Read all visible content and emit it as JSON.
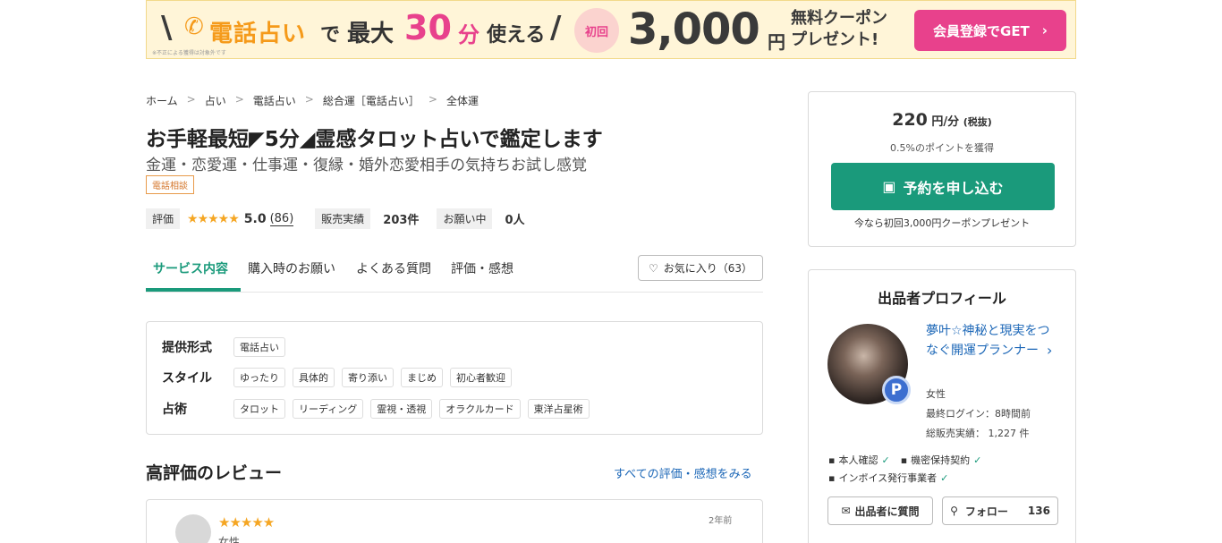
{
  "banner": {
    "line1": "電話占い",
    "line2": "で",
    "line3": "最大",
    "minutes": "30",
    "minutes_unit": "分",
    "line4": "使える",
    "first_time": "初回",
    "amount": "3,000",
    "yen": "円",
    "coupon_line1": "無料クーポン",
    "coupon_line2": "プレゼント!",
    "note": "※不正による獲得は対象外です",
    "cta": "会員登録でGET"
  },
  "breadcrumb": [
    "ホーム",
    "占い",
    "電話占い",
    "総合運［電話占い］",
    "全体運"
  ],
  "title": "お手軽最短◤5分◢霊感タロット占いで鑑定します",
  "subtitle": "金運・恋愛運・仕事運・復縁・婚外恋愛相手の気持ちお試し感覚",
  "category_tag": "電話相談",
  "stats": {
    "rating_label": "評価",
    "stars": "★★★★★",
    "rating": "5.0",
    "rating_count": "(86)",
    "sales_label": "販売実績",
    "sales_value": "203件",
    "requests_label": "お願い中",
    "requests_value": "0人"
  },
  "tabs": [
    "サービス内容",
    "購入時のお願い",
    "よくある質問",
    "評価・感想"
  ],
  "favorite": "お気に入り（63）",
  "spec": {
    "format_label": "提供形式",
    "format": [
      "電話占い"
    ],
    "style_label": "スタイル",
    "styles": [
      "ゆったり",
      "具体的",
      "寄り添い",
      "まじめ",
      "初心者歓迎"
    ],
    "method_label": "占術",
    "methods": [
      "タロット",
      "リーディング",
      "霊視・透視",
      "オラクルカード",
      "東洋占星術"
    ]
  },
  "reviews": {
    "title": "高評価のレビュー",
    "link": "すべての評価・感想をみる",
    "items": [
      {
        "stars": "★★★★★",
        "gender": "女性",
        "date": "2年前"
      }
    ]
  },
  "price_box": {
    "price": "220",
    "unit": "円/分",
    "tax": "(税抜)",
    "points": "0.5%のポイントを獲得",
    "reserve": "予約を申し込む",
    "coupon_note": "今なら初回3,000円クーポンプレゼント"
  },
  "profile": {
    "title": "出品者プロフィール",
    "name": "夢叶☆神秘と現実をつなぐ開運プランナー",
    "badge": "P",
    "gender": "女性",
    "last_login": "最終ログイン：8時間前",
    "total_sales": "総販売実績： 1,227 件",
    "verify_identity": "本人確認",
    "verify_nda": "機密保持契約",
    "verify_invoice": "インボイス発行事業者",
    "ask_button": "出品者に質問",
    "follow_button": "フォロー",
    "follow_count": "136"
  },
  "colors": {
    "accent": "#1a9a7b",
    "pink": "#e8418c",
    "orange": "#f59a1a",
    "link": "#1c67b7",
    "star": "#f5a623"
  }
}
